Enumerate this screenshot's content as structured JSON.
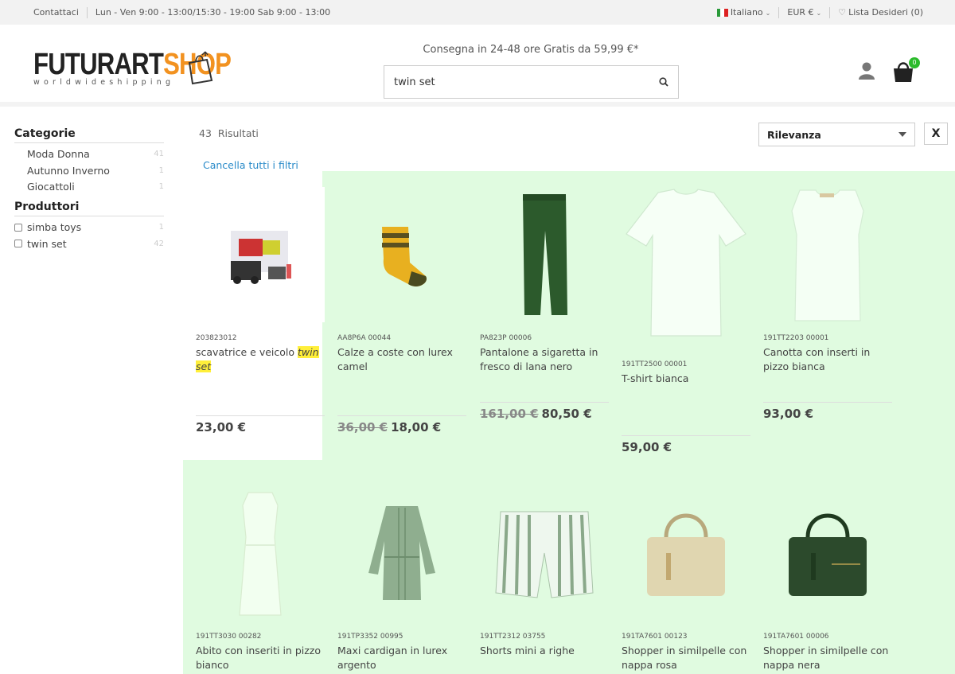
{
  "topbar": {
    "contact": "Contattaci",
    "hours": "Lun - Ven 9:00 - 13:00/15:30 - 19:00 Sab 9:00 - 13:00",
    "language": "Italiano",
    "currency": "EUR €",
    "wishlist": "Lista Desideri (0)"
  },
  "header": {
    "logo_main": "FUTURART",
    "logo_accent": "SHOP",
    "logo_sub": "worldwideshipping",
    "delivery": "Consegna in 24-48 ore Gratis da 59,99 €*",
    "search_value": "twin set",
    "cart_count": "0",
    "accent_color": "#f29220"
  },
  "sidebar": {
    "categories_title": "Categorie",
    "categories": [
      {
        "label": "Moda Donna",
        "count": "41"
      },
      {
        "label": "Autunno Inverno",
        "count": "1"
      },
      {
        "label": "Giocattoli",
        "count": "1"
      }
    ],
    "manufacturers_title": "Produttori",
    "manufacturers": [
      {
        "label": "simba toys",
        "count": "1"
      },
      {
        "label": "twin set",
        "count": "42"
      }
    ]
  },
  "results": {
    "count": "43",
    "count_label": "Risultati",
    "clear_filters": "Cancella tutti i filtri",
    "sort_value": "Rilevanza",
    "close_label": "X"
  },
  "products": [
    {
      "sku": "203823012",
      "name_before": "scavatrice e veicolo ",
      "name_highlight_1": "twin",
      "name_highlight_2": "set",
      "price": "23,00 €",
      "icon": "toy-box-image"
    },
    {
      "sku": "AA8P6A 00044",
      "name": "Calze a coste con lurex camel",
      "old_price": "36,00 €",
      "price": "18,00 €",
      "icon": "sock-image"
    },
    {
      "sku": "PA823P 00006",
      "name": "Pantalone a sigaretta in fresco di lana nero",
      "old_price": "161,00 €",
      "price": "80,50 €",
      "icon": "trousers-image"
    },
    {
      "sku": "191TT2500 00001",
      "name": "T-shirt bianca",
      "price": "59,00 €",
      "icon": "tshirt-image"
    },
    {
      "sku": "191TT2203 00001",
      "name": "Canotta con inserti in pizzo bianca",
      "price": "93,00 €",
      "icon": "tank-top-image"
    },
    {
      "sku": "191TT3030 00282",
      "name": "Abito con inseriti in pizzo bianco",
      "icon": "dress-image"
    },
    {
      "sku": "191TP3352 00995",
      "name": "Maxi cardigan in lurex argento",
      "icon": "cardigan-image"
    },
    {
      "sku": "191TT2312 03755",
      "name": "Shorts mini a righe",
      "icon": "shorts-image"
    },
    {
      "sku": "191TA7601 00123",
      "name": "Shopper in similpelle con nappa rosa",
      "icon": "handbag-image"
    },
    {
      "sku": "191TA7601 00006",
      "name": "Shopper in similpelle con nappa nera",
      "icon": "handbag-image"
    }
  ]
}
